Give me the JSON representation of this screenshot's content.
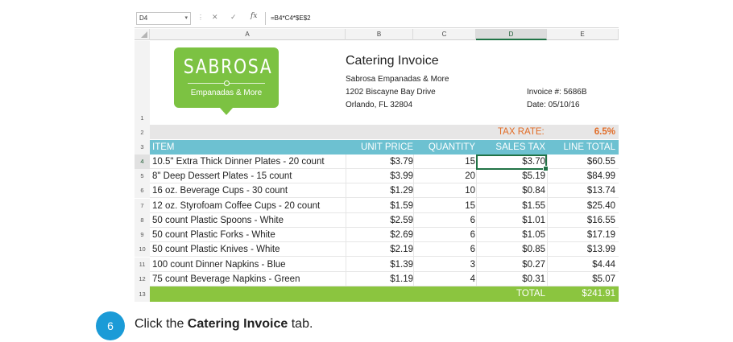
{
  "formula_bar": {
    "name_box": "D4",
    "formula": "=B4*C4*$E$2",
    "fx_label": "fx"
  },
  "column_headers": [
    "A",
    "B",
    "C",
    "D",
    "E"
  ],
  "row_numbers": [
    "1",
    "2",
    "3",
    "4",
    "5",
    "6",
    "7",
    "8",
    "9",
    "10",
    "11",
    "12",
    "13"
  ],
  "logo": {
    "name": "SABROSA",
    "tagline": "Empanadas & More"
  },
  "invoice": {
    "title": "Catering Invoice",
    "company": "Sabrosa Empanadas & More",
    "address": "1202 Biscayne Bay Drive",
    "city": "Orlando, FL 32804",
    "invoice_no": "Invoice #:  5686B",
    "date": "Date:  05/10/16"
  },
  "tax": {
    "label": "TAX RATE:",
    "value": "6.5%"
  },
  "table_headers": {
    "item": "ITEM",
    "unit_price": "UNIT PRICE",
    "quantity": "QUANTITY",
    "sales_tax": "SALES TAX",
    "line_total": "LINE TOTAL"
  },
  "rows": [
    {
      "item": "10.5\" Extra Thick Dinner Plates - 20 count",
      "price": "$3.79",
      "qty": "15",
      "tax": "$3.70",
      "total": "$60.55"
    },
    {
      "item": "8\" Deep Dessert Plates - 15 count",
      "price": "$3.99",
      "qty": "20",
      "tax": "$5.19",
      "total": "$84.99"
    },
    {
      "item": "16 oz. Beverage Cups - 30 count",
      "price": "$1.29",
      "qty": "10",
      "tax": "$0.84",
      "total": "$13.74"
    },
    {
      "item": "12 oz. Styrofoam Coffee Cups - 20 count",
      "price": "$1.59",
      "qty": "15",
      "tax": "$1.55",
      "total": "$25.40"
    },
    {
      "item": "50 count Plastic Spoons - White",
      "price": "$2.59",
      "qty": "6",
      "tax": "$1.01",
      "total": "$16.55"
    },
    {
      "item": "50 count Plastic Forks - White",
      "price": "$2.69",
      "qty": "6",
      "tax": "$1.05",
      "total": "$17.19"
    },
    {
      "item": "50 count Plastic Knives - White",
      "price": "$2.19",
      "qty": "6",
      "tax": "$0.85",
      "total": "$13.99"
    },
    {
      "item": "100 count Dinner Napkins - Blue",
      "price": "$1.39",
      "qty": "3",
      "tax": "$0.27",
      "total": "$4.44"
    },
    {
      "item": "75 count Beverage Napkins - Green",
      "price": "$1.19",
      "qty": "4",
      "tax": "$0.31",
      "total": "$5.07"
    }
  ],
  "total_row": {
    "label": "TOTAL",
    "value": "$241.91"
  },
  "step": {
    "number": "6",
    "text_before": "Click the ",
    "text_bold": "Catering Invoice",
    "text_after": " tab."
  },
  "colors": {
    "logo_green": "#7cc242",
    "header_teal": "#6dc1d1",
    "total_green": "#8bc53f",
    "tax_orange": "#e26b25",
    "step_blue": "#1b9bd7",
    "excel_green": "#217346"
  }
}
